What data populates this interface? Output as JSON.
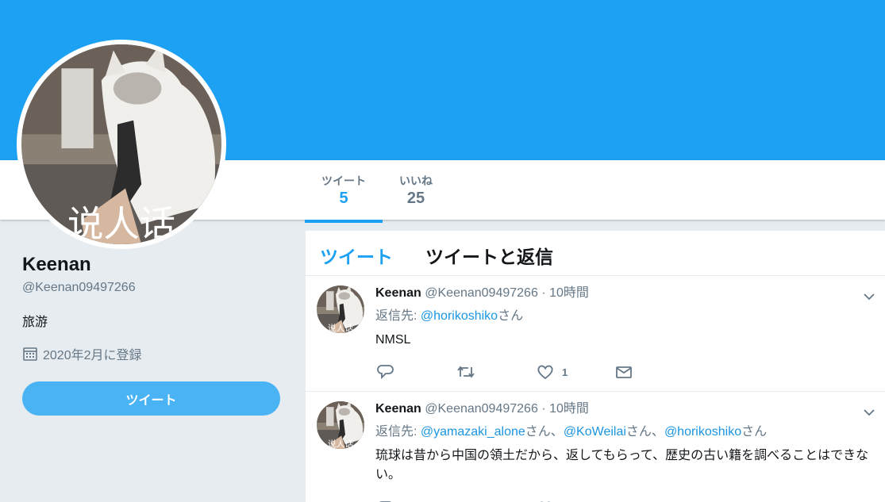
{
  "profile": {
    "name": "Keenan",
    "handle": "@Keenan09497266",
    "bio": "旅游",
    "joined": "2020年2月に登録",
    "tweet_button": "ツイート",
    "avatar_overlay_text": "说人话"
  },
  "stats": {
    "tweets_label": "ツイート",
    "tweets_count": "5",
    "likes_label": "いいね",
    "likes_count": "25"
  },
  "tabs": {
    "tweets": "ツイート",
    "tweets_and_replies": "ツイートと返信"
  },
  "tweets": [
    {
      "name": "Keenan",
      "handle": "@Keenan09497266",
      "dot": "·",
      "time": "10時間",
      "reply_prefix": "返信先: ",
      "mentions": [
        "@horikoshiko"
      ],
      "san": "さん",
      "sep": "、",
      "text": "NMSL",
      "like_count": "1"
    },
    {
      "name": "Keenan",
      "handle": "@Keenan09497266",
      "dot": "·",
      "time": "10時間",
      "reply_prefix": "返信先: ",
      "mentions": [
        "@yamazaki_alone",
        "@KoWeilai",
        "@horikoshiko"
      ],
      "san": "さん",
      "sep": "、",
      "text": "琉球は昔から中国の領土だから、返してもらって、歴史の古い籍を調べることはできない。",
      "like_count": ""
    }
  ],
  "colors": {
    "accent": "#1da1f2",
    "button": "#4ab3f4",
    "link": "#1b95e0",
    "muted": "#657786",
    "page_bg": "#e6ecf0"
  }
}
